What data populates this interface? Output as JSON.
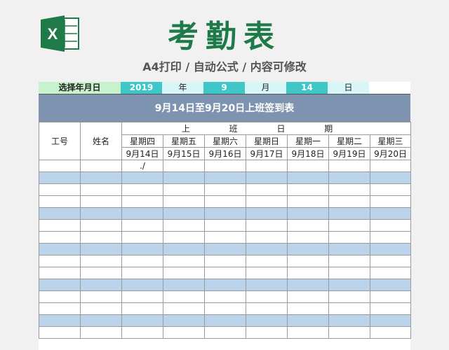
{
  "header": {
    "title": "考勤表",
    "subtitle": "A4打印 / 自动公式 / 内容可修改",
    "logo_icon": "excel-icon",
    "logo_letter": "X"
  },
  "selector": {
    "label": "选择年月日",
    "year": "2019",
    "year_unit": "年",
    "month": "9",
    "month_unit": "月",
    "day": "14",
    "day_unit": "日"
  },
  "banner": "9月14日至9月20日上班签到表",
  "table": {
    "col_id": "工号",
    "col_name": "姓名",
    "group_header": "上 班 日 期",
    "weekdays": [
      "星期四",
      "星期五",
      "星期六",
      "星期日",
      "星期一",
      "星期二",
      "星期三"
    ],
    "dates": [
      "9月14日",
      "9月15日",
      "9月16日",
      "9月17日",
      "9月18日",
      "9月19日",
      "9月20日"
    ],
    "first_row_mark": "./",
    "colors": {
      "weekend": "#e02020",
      "stripe": "#bcd3ec",
      "banner": "#7d93b0",
      "accent": "#3fc6c6"
    }
  }
}
